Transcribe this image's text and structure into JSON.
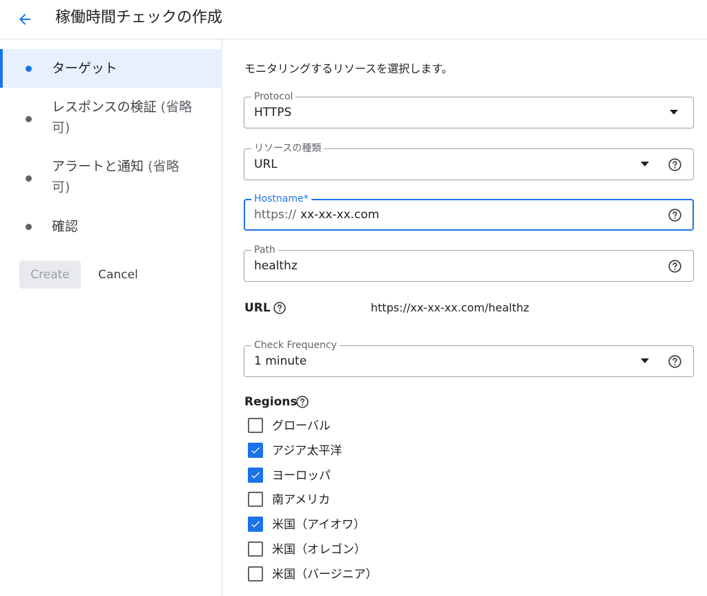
{
  "header": {
    "back_icon": "arrow-back-icon",
    "title": "稼働時間チェックの作成"
  },
  "sidebar": {
    "steps": [
      {
        "label": "ターゲット",
        "hint": "",
        "hint2": "",
        "active": true
      },
      {
        "label": "レスポンスの検証 ",
        "hint": "(省略",
        "hint2": "可)",
        "active": false
      },
      {
        "label": "アラートと通知 ",
        "hint": "(省略",
        "hint2": "可)",
        "active": false
      },
      {
        "label": "確認",
        "hint": "",
        "hint2": "",
        "active": false
      }
    ],
    "create_label": "Create",
    "cancel_label": "Cancel"
  },
  "main": {
    "description": "モニタリングするリソースを選択します。",
    "protocol": {
      "label": "Protocol",
      "value": "HTTPS"
    },
    "resource_type": {
      "label": "リソースの種類",
      "value": "URL"
    },
    "hostname": {
      "label": "Hostname*",
      "prefix": "https://",
      "value": "xx-xx-xx.com"
    },
    "path": {
      "label": "Path",
      "value": "healthz"
    },
    "url": {
      "label": "URL",
      "value": "https://xx-xx-xx.com/healthz"
    },
    "check_frequency": {
      "label": "Check Frequency",
      "value": "1 minute"
    },
    "regions": {
      "label": "Regions",
      "items": [
        {
          "label": "グローバル",
          "checked": false
        },
        {
          "label": "アジア太平洋",
          "checked": true
        },
        {
          "label": "ヨーロッパ",
          "checked": true
        },
        {
          "label": "南アメリカ",
          "checked": false
        },
        {
          "label": "米国（アイオワ）",
          "checked": true
        },
        {
          "label": "米国（オレゴン）",
          "checked": false
        },
        {
          "label": "米国（バージニア）",
          "checked": false
        }
      ]
    }
  },
  "colors": {
    "accent": "#1a73e8",
    "active_step_bg": "#e8f0fe",
    "disabled_button_bg": "#e8eaed"
  }
}
